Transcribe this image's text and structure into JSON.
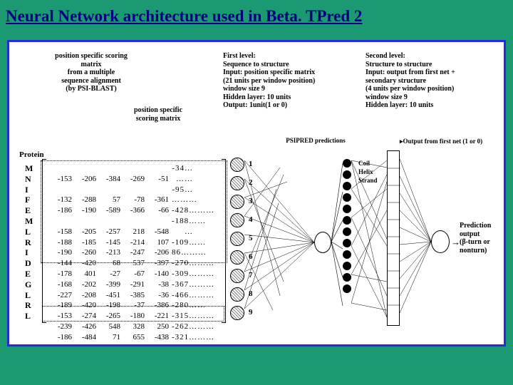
{
  "title": "Neural Network architecture used in Beta. TPred 2",
  "pssm_desc": "position specific scoring\nmatrix\nfrom a multiple\nsequence alignment\n(by PSI-BLAST)",
  "pssm_right_desc": "position specific\nscoring matrix",
  "protein_label": "Protein",
  "first_level_desc": "First level:\nSequence to structure\nInput: position specific matrix\n(21 units per window position)\nwindow size 9\nHidden layer: 10 units\nOutput: 1unit(1 or 0)",
  "psipred_label": "PSIPRED predictions",
  "second_level_desc": "Second level:\nStructure to structure\nInput: output from first net +\nsecondary structure\n(4 units per window position)\nwindow size 9\nHidden layer: 10 units",
  "legend_output_first": "Output from first net (1 or 0)",
  "legend": [
    "Coil",
    "Helix",
    "Strand"
  ],
  "prediction_desc": "Prediction\noutput\n(β-turn or\nnonturn)",
  "protein_seq": [
    "M",
    "N",
    "I",
    "F",
    "E",
    "M",
    "L",
    "R",
    "I",
    "D",
    "E",
    "G",
    "L",
    "R",
    "L"
  ],
  "window_numbers": [
    "1",
    "2",
    "3",
    "4",
    "5",
    "6",
    "7",
    "8",
    "9"
  ],
  "matrix_rows": [
    [
      "-153",
      "-206",
      "-384",
      "-269",
      "-51",
      "-34… ……"
    ],
    [
      "-132",
      "-288",
      "57",
      "-78",
      "-361",
      "-95… ………"
    ],
    [
      "-186",
      "-190",
      "-589",
      "-366",
      "-66",
      "-428………"
    ],
    [
      "-158",
      "-205",
      "-257",
      "218",
      "-548",
      "-188…… …"
    ],
    [
      "-188",
      "-185",
      "-145",
      "-214",
      "107",
      "-109……"
    ],
    [
      "-190",
      "-260",
      "-213",
      "-247",
      "-206",
      "86………"
    ],
    [
      "-144",
      "-420",
      "68",
      "537",
      "-397",
      "-270………"
    ],
    [
      "-178",
      "401",
      "-27",
      "-67",
      "-140",
      "-309………"
    ],
    [
      "-168",
      "-202",
      "-399",
      "-291",
      "-38",
      "-367………"
    ],
    [
      "-227",
      "-208",
      "-451",
      "-385",
      "-36",
      "-466………"
    ],
    [
      "-189",
      "-420",
      "-198",
      "-37",
      "-386",
      "-280……"
    ],
    [
      "-153",
      "-274",
      "-265",
      "-180",
      "-221",
      "-315………"
    ],
    [
      "-239",
      "-426",
      "548",
      "328",
      "250",
      "-262………"
    ],
    [
      "-186",
      "-484",
      "71",
      "655",
      "-438",
      "-321………"
    ]
  ]
}
